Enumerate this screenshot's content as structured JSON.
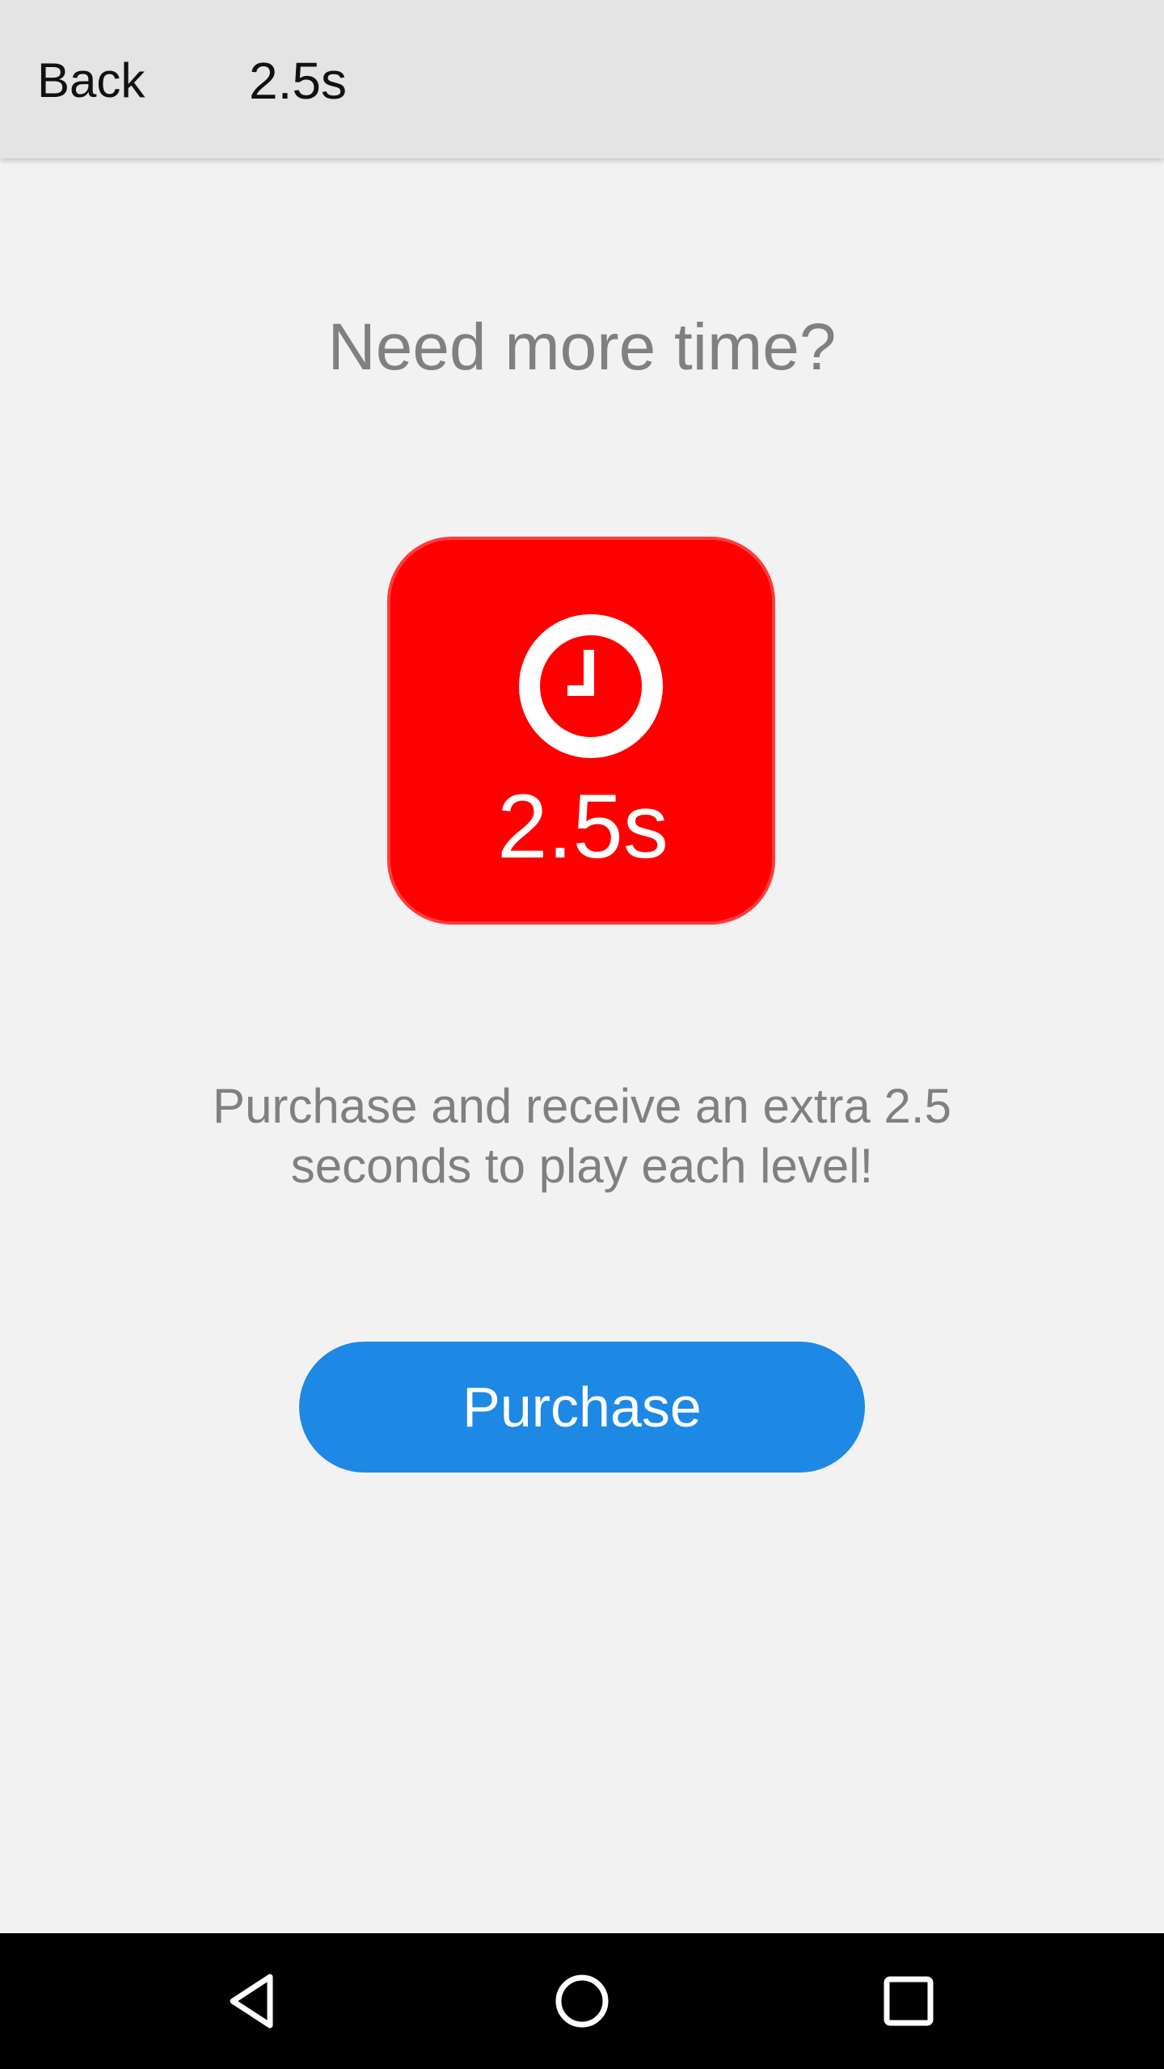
{
  "header": {
    "back_label": "Back",
    "title": "2.5s"
  },
  "main": {
    "headline": "Need more time?",
    "tile": {
      "icon": "clock-icon",
      "label": "2.5s",
      "color": "#ff0000"
    },
    "description": "Purchase and receive an extra 2.5 seconds to play each level!",
    "purchase_button_label": "Purchase",
    "purchase_button_color": "#1e88e5"
  },
  "navigation_bar": {
    "buttons": [
      "back-triangle-icon",
      "home-circle-icon",
      "recents-square-icon"
    ]
  }
}
